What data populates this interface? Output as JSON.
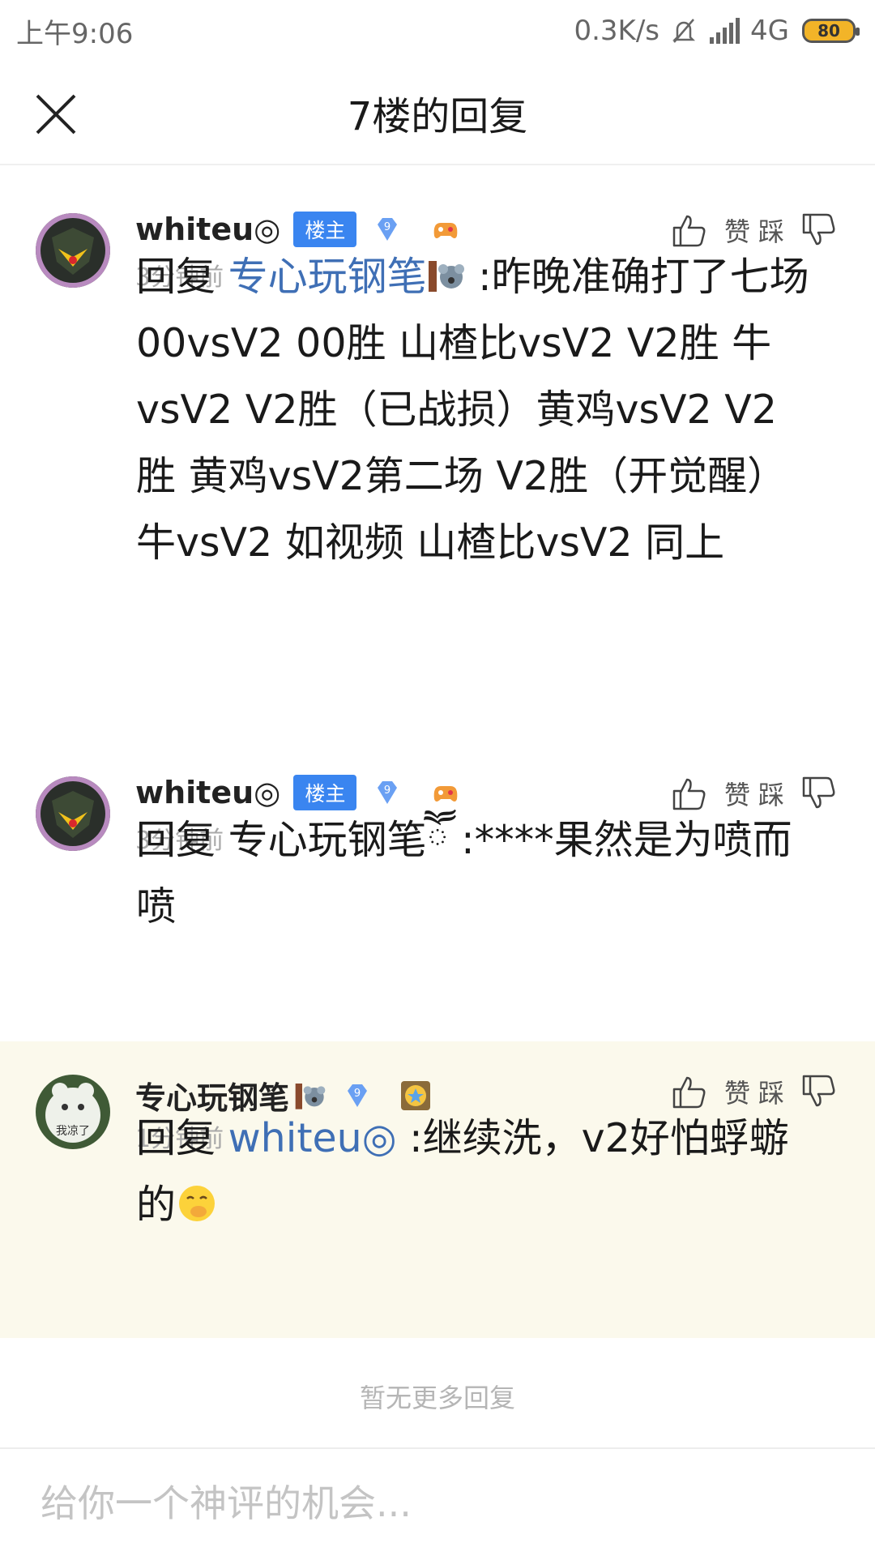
{
  "status_bar": {
    "time": "上午9:06",
    "net_speed": "0.3K/s",
    "network": "4G",
    "battery": "80",
    "battery_color": "#f2b428"
  },
  "header": {
    "title": "7楼的回复",
    "close_icon": "close-icon"
  },
  "comments": [
    {
      "username": "whiteu◎",
      "owner_badge": "楼主",
      "level": "9",
      "time": "3分钟前",
      "like_label": "赞",
      "dislike_label": "踩",
      "reply_prefix": "回复 ",
      "mention": "专心玩钢笔",
      "text": " :昨晚准确打了七场 00vsV2 00胜 山楂比vsV2 V2胜 牛vsV2 V2胜（已战损）黄鸡vsV2 V2胜 黄鸡vsV2第二场 V2胜（开觉醒）牛vsV2 如视频 山楂比vsV2 同上"
    },
    {
      "username": "whiteu◎",
      "owner_badge": "楼主",
      "level": "9",
      "time": "3分钟前",
      "like_label": "赞",
      "dislike_label": "踩",
      "reply_prefix": "回复 ",
      "mention": "专心玩钢笔",
      "mention_suffix": "ཽ",
      "text": " :****果然是为喷而喷"
    },
    {
      "username": "专心玩钢笔",
      "level": "9",
      "time": "1分钟前",
      "like_label": "赞",
      "dislike_label": "踩",
      "reply_prefix": "回复 ",
      "mention": "whiteu◎",
      "text": " :继续洗，v2好怕蜉蝣的",
      "avatar_text": "我凉了",
      "highlight_color": "#fbf9ec"
    }
  ],
  "no_more_text": "暂无更多回复",
  "input": {
    "placeholder": "给你一个神评的机会..."
  },
  "colors": {
    "mention": "#3f6fb5",
    "owner_badge": "#3a85f0"
  }
}
